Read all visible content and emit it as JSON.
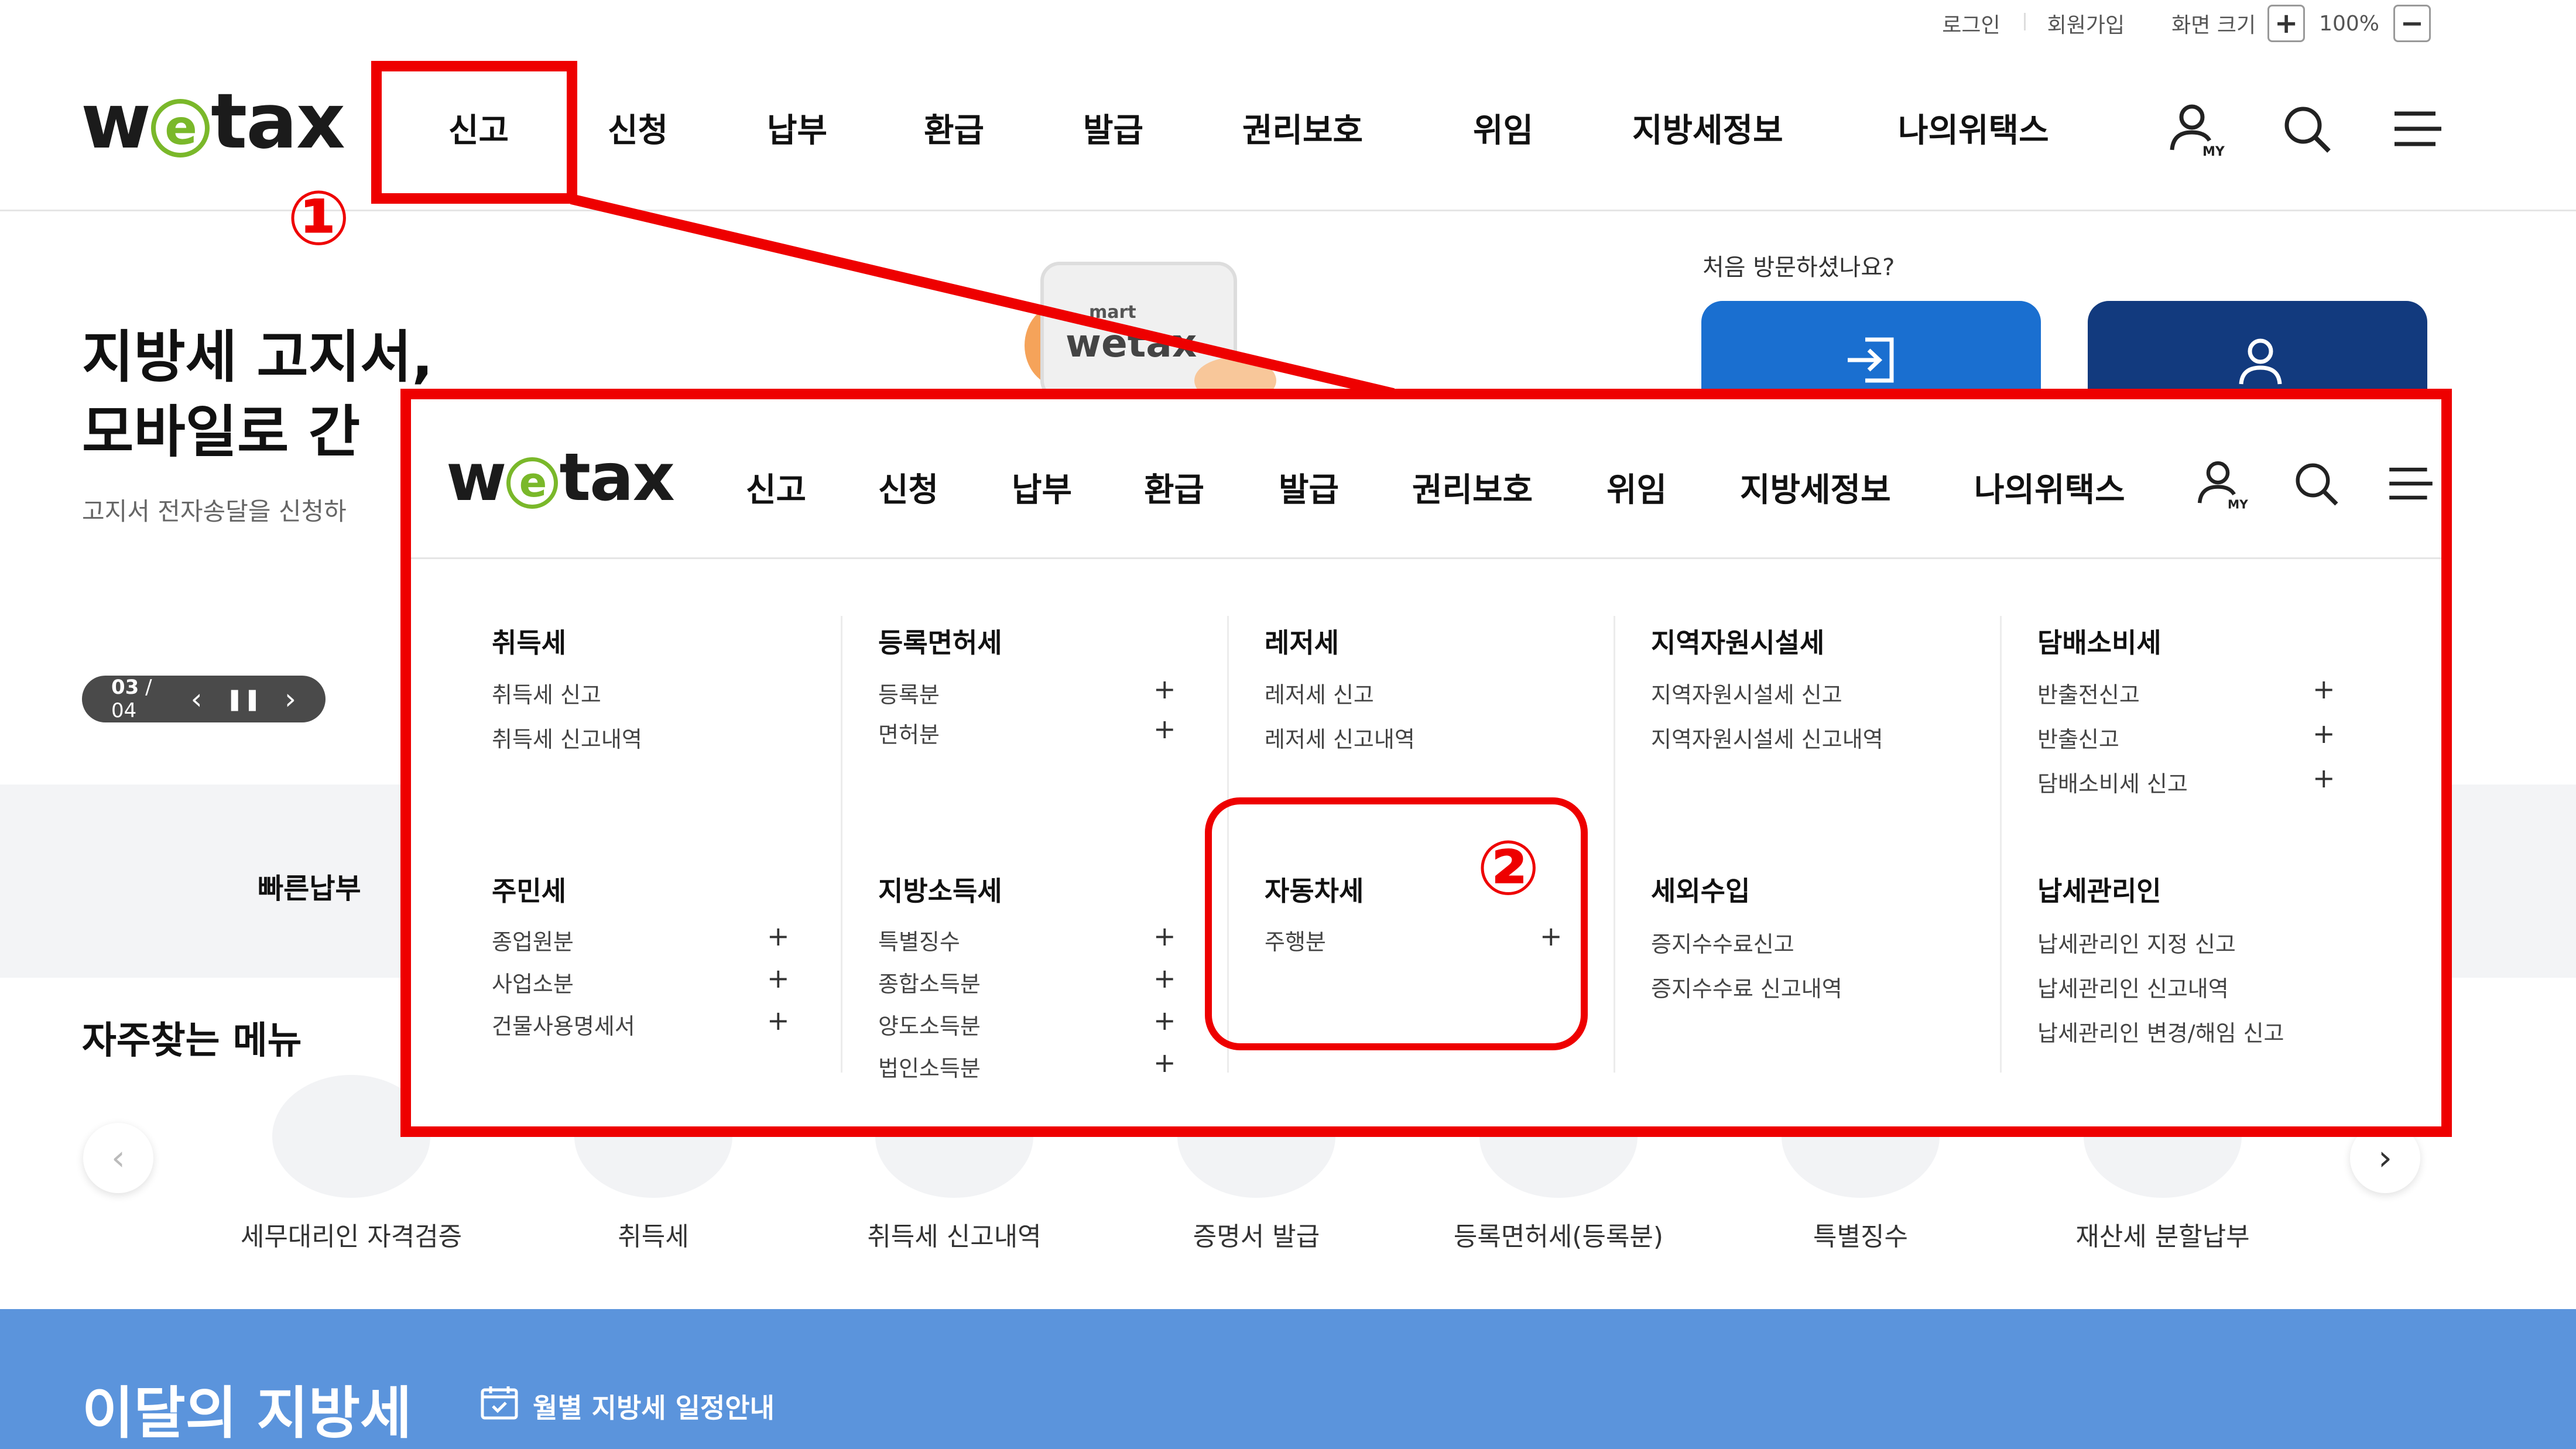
{
  "utility": {
    "login": "로그인",
    "signup": "회원가입",
    "screen_size": "화면 크기",
    "zoom_in": "+",
    "zoom_value": "100%",
    "zoom_out": "−"
  },
  "logo": {
    "pre": "w",
    "e": "e",
    "post": "tax"
  },
  "nav": [
    "신고",
    "신청",
    "납부",
    "환급",
    "발급",
    "권리보호",
    "위임",
    "지방세정보",
    "나의위택스"
  ],
  "icons": {
    "my": "my-user-icon",
    "search": "search-icon",
    "menu": "hamburger-menu-icon",
    "my_label": "MY"
  },
  "hero": {
    "title": "지방세 고지서,\n모바일로 간",
    "subtitle": "고지서 전자송달을 신청하",
    "slide_current": "03",
    "slide_total": "/ 04",
    "image_text": "wetax",
    "image_small": "mart"
  },
  "visit": {
    "question": "처음 방문하셨나요?"
  },
  "quick_pay": "빠른납부",
  "frequent": {
    "title": "자주찾는 메뉴",
    "items": [
      "세무대리인 자격검증",
      "취득세",
      "취득세 신고내역",
      "증명서 발급",
      "등록면허세(등록분)",
      "특별징수",
      "재산세 분할납부"
    ]
  },
  "month": {
    "title": "이달의 지방세",
    "link": "월별 지방세 일정안내"
  },
  "annotations": {
    "one": "①",
    "two": "②"
  },
  "dropdown": {
    "groups": [
      {
        "title": "취득세",
        "items": [
          {
            "label": "취득세 신고",
            "plus": false
          },
          {
            "label": "취득세 신고내역",
            "plus": false
          }
        ]
      },
      {
        "title": "등록면허세",
        "items": [
          {
            "label": "등록분",
            "plus": true
          },
          {
            "label": "면허분",
            "plus": true
          }
        ]
      },
      {
        "title": "레저세",
        "items": [
          {
            "label": "레저세 신고",
            "plus": false
          },
          {
            "label": "레저세 신고내역",
            "plus": false
          }
        ]
      },
      {
        "title": "지역자원시설세",
        "items": [
          {
            "label": "지역자원시설세 신고",
            "plus": false
          },
          {
            "label": "지역자원시설세 신고내역",
            "plus": false
          }
        ]
      },
      {
        "title": "담배소비세",
        "items": [
          {
            "label": "반출전신고",
            "plus": true
          },
          {
            "label": "반출신고",
            "plus": true
          },
          {
            "label": "담배소비세 신고",
            "plus": true
          }
        ]
      },
      {
        "title": "주민세",
        "items": [
          {
            "label": "종업원분",
            "plus": true
          },
          {
            "label": "사업소분",
            "plus": true
          },
          {
            "label": "건물사용명세서",
            "plus": true
          }
        ]
      },
      {
        "title": "지방소득세",
        "items": [
          {
            "label": "특별징수",
            "plus": true
          },
          {
            "label": "종합소득분",
            "plus": true
          },
          {
            "label": "양도소득분",
            "plus": true
          },
          {
            "label": "법인소득분",
            "plus": true
          }
        ]
      },
      {
        "title": "자동차세",
        "items": [
          {
            "label": "주행분",
            "plus": true
          }
        ]
      },
      {
        "title": "세외수입",
        "items": [
          {
            "label": "증지수수료신고",
            "plus": false
          },
          {
            "label": "증지수수료 신고내역",
            "plus": false
          }
        ]
      },
      {
        "title": "납세관리인",
        "items": [
          {
            "label": "납세관리인 지정 신고",
            "plus": false
          },
          {
            "label": "납세관리인 신고내역",
            "plus": false
          },
          {
            "label": "납세관리인 변경/해임 신고",
            "plus": false
          }
        ]
      }
    ],
    "plus_symbol": "+"
  },
  "colors": {
    "annotation_red": "#ee0000",
    "logo_green": "#7ab82a",
    "login_blue": "#1a6fd0",
    "join_navy": "#123a7e",
    "band_blue": "#5b94dc"
  }
}
